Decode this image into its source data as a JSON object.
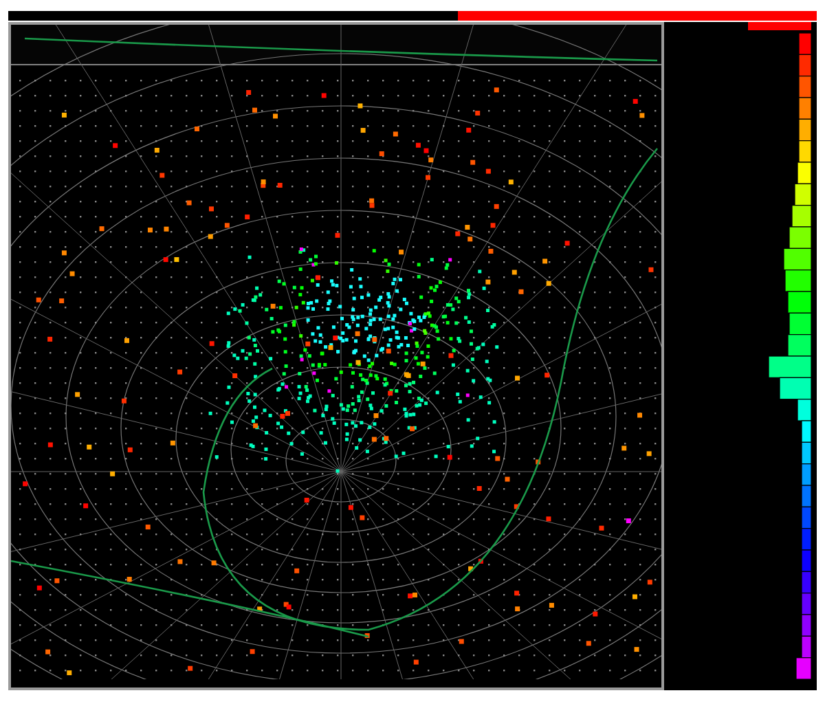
{
  "panels": [
    {
      "kind": "event-map"
    },
    {
      "kind": "histogram"
    }
  ]
}
